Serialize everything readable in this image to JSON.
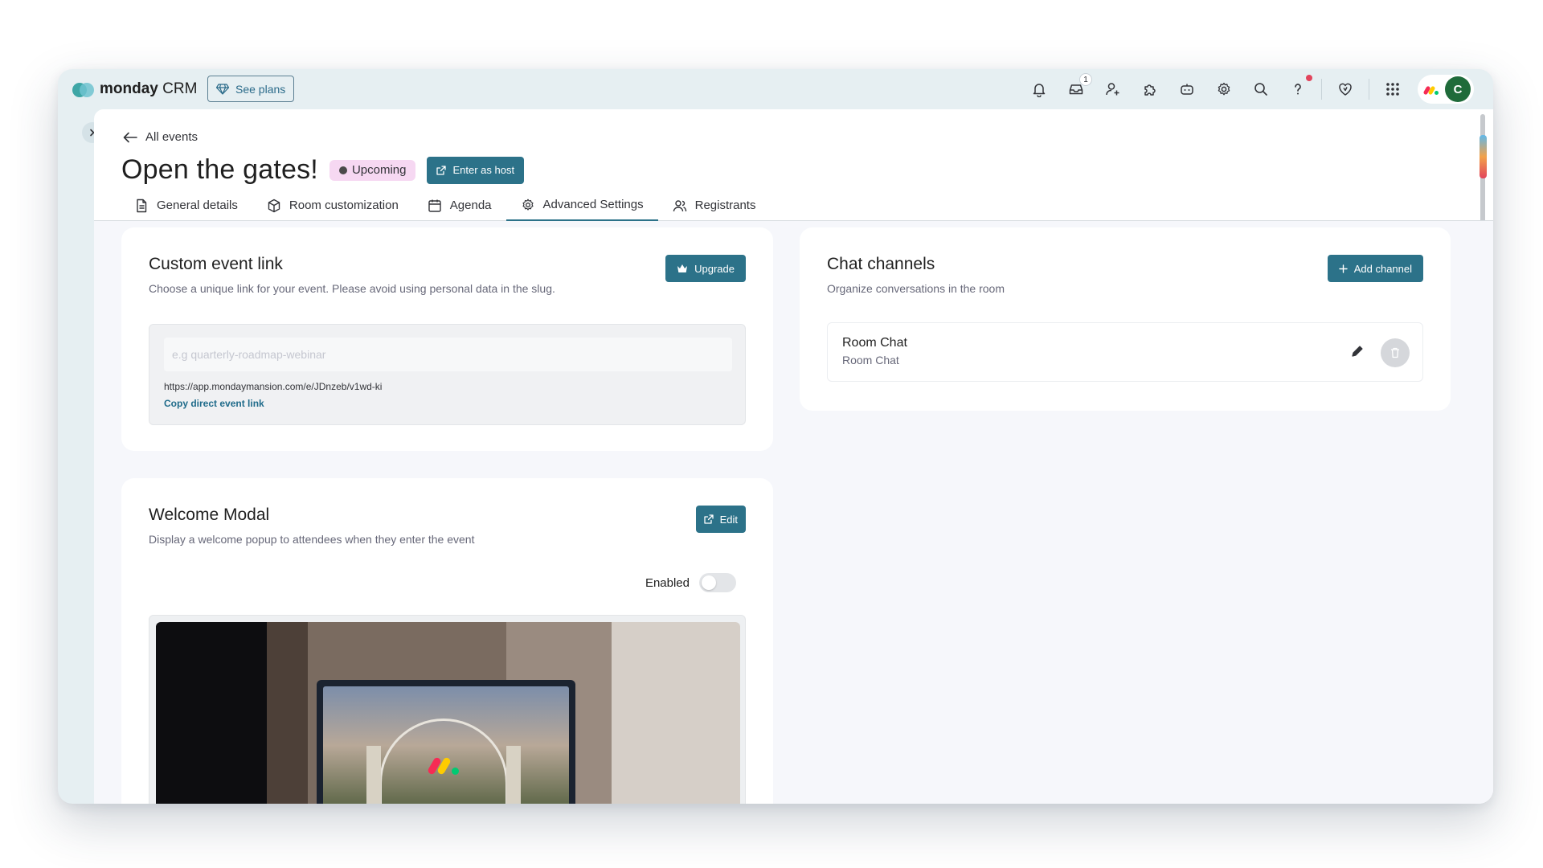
{
  "topbar": {
    "brand_bold": "monday",
    "brand_light": " CRM",
    "see_plans": "See plans",
    "inbox_count": "1",
    "avatar_initial": "C",
    "icons": [
      "bell-icon",
      "inbox-icon",
      "invite-members-icon",
      "apps-icon",
      "ai-assistant-icon",
      "settings-icon",
      "search-icon",
      "help-icon",
      "heart-icon",
      "app-grid-icon"
    ]
  },
  "page": {
    "back_label": "All events",
    "title": "Open the gates!",
    "status": "Upcoming",
    "enter_host": "Enter as host"
  },
  "tabs": [
    {
      "label": "General details",
      "icon": "document-icon"
    },
    {
      "label": "Room customization",
      "icon": "cube-icon"
    },
    {
      "label": "Agenda",
      "icon": "calendar-icon"
    },
    {
      "label": "Advanced Settings",
      "icon": "gear-icon",
      "active": true
    },
    {
      "label": "Registrants",
      "icon": "people-icon"
    }
  ],
  "custom_link": {
    "title": "Custom event link",
    "description": "Choose a unique link for your event. Please avoid using personal data in the slug.",
    "upgrade": "Upgrade",
    "placeholder": "e.g quarterly-roadmap-webinar",
    "url": "https://app.mondaymansion.com/e/JDnzeb/v1wd-ki",
    "copy": "Copy direct event link"
  },
  "welcome_modal": {
    "title": "Welcome Modal",
    "description": "Display a welcome popup to attendees when they enter the event",
    "edit": "Edit",
    "enabled_label": "Enabled",
    "enabled": false
  },
  "chat_channels": {
    "title": "Chat channels",
    "description": "Organize conversations in the room",
    "add": "Add channel",
    "items": [
      {
        "name": "Room Chat",
        "subtitle": "Room Chat"
      }
    ]
  },
  "colors": {
    "accent": "#2c7289",
    "status_pill": "#f6d8f2",
    "window_bg": "#e6eff2"
  }
}
